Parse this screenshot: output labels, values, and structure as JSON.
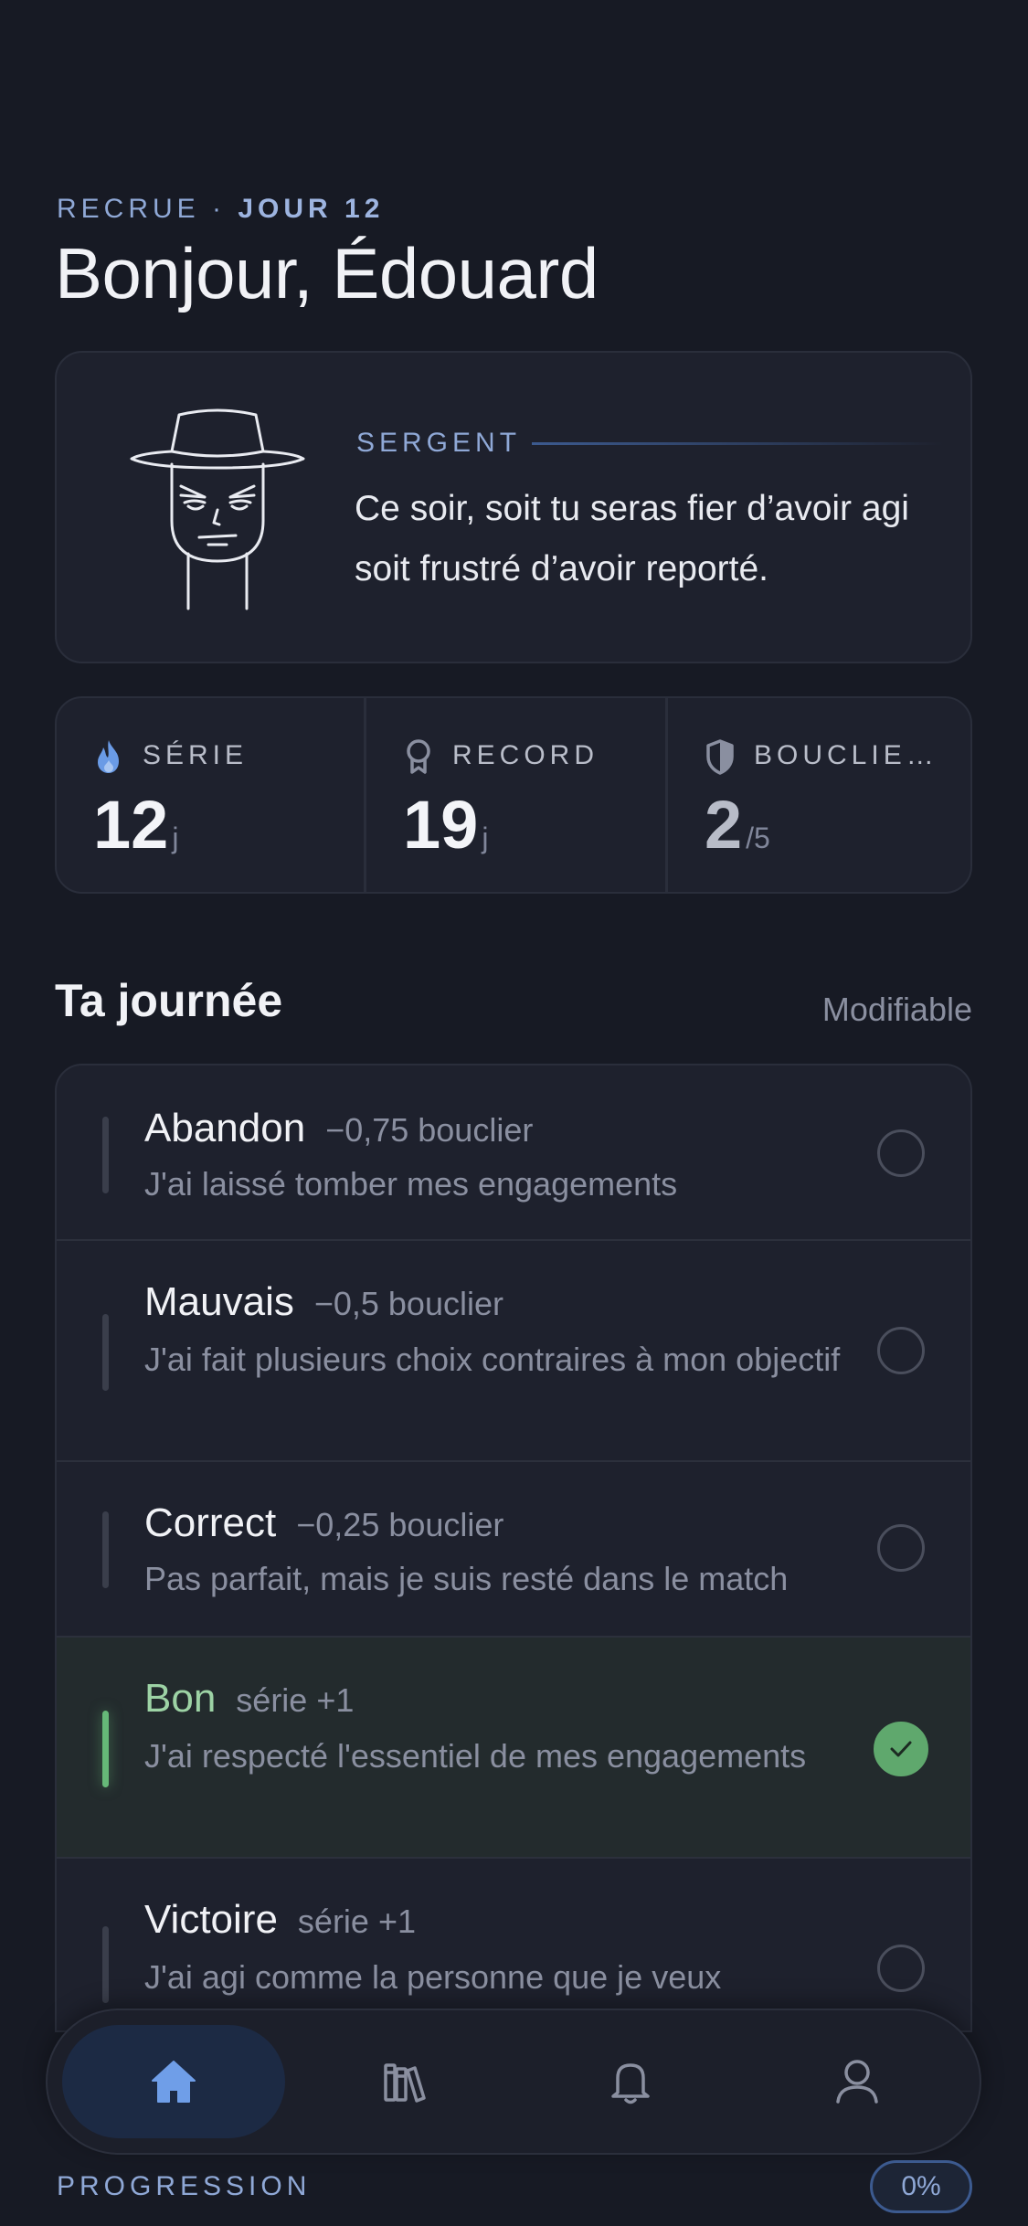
{
  "header": {
    "rank": "RECRUE",
    "separator": " · ",
    "day": "JOUR 12",
    "greeting": "Bonjour, Édouard"
  },
  "coach": {
    "label": "SERGENT",
    "avatar_icon": "sergeant-portrait-icon",
    "quote": "Ce soir, soit tu seras fier d’avoir agi soit frustré d’avoir reporté."
  },
  "stats": [
    {
      "icon": "flame-icon",
      "label": "SÉRIE",
      "value": "12",
      "unit": "j",
      "color": "#6a9be6"
    },
    {
      "icon": "medal-icon",
      "label": "RECORD",
      "value": "19",
      "unit": "j",
      "color": "#8a8fa0"
    },
    {
      "icon": "shield-icon",
      "label": "BOUCLIE…",
      "value": "2",
      "unit": "/5",
      "color": "#8a8fa0"
    }
  ],
  "day_section": {
    "title": "Ta journée",
    "action": "Modifiable"
  },
  "options": [
    {
      "title": "Abandon",
      "meta": "−0,75 bouclier",
      "desc": "J'ai laissé tomber mes engagements",
      "selected": false
    },
    {
      "title": "Mauvais",
      "meta": "−0,5 bouclier",
      "desc": "J'ai fait plusieurs choix contraires à mon objectif",
      "selected": false
    },
    {
      "title": "Correct",
      "meta": "−0,25 bouclier",
      "desc": "Pas parfait, mais je suis resté dans le match",
      "selected": false
    },
    {
      "title": "Bon",
      "meta": "série +1",
      "desc": "J'ai respecté l'essentiel de mes engagements",
      "selected": true
    },
    {
      "title": "Victoire",
      "meta": "série +1",
      "desc": "J'ai agi comme la personne que je veux",
      "selected": false
    }
  ],
  "tabbar": [
    {
      "icon": "home-icon",
      "active": true
    },
    {
      "icon": "books-icon",
      "active": false
    },
    {
      "icon": "bell-icon",
      "active": false
    },
    {
      "icon": "profile-icon",
      "active": false
    }
  ],
  "progress": {
    "label": "PROGRESSION",
    "value": "0%"
  },
  "colors": {
    "background": "#171a24",
    "card": "#1e212d",
    "accent_blue": "#8fa8d6",
    "success_green": "#5fa86d"
  }
}
